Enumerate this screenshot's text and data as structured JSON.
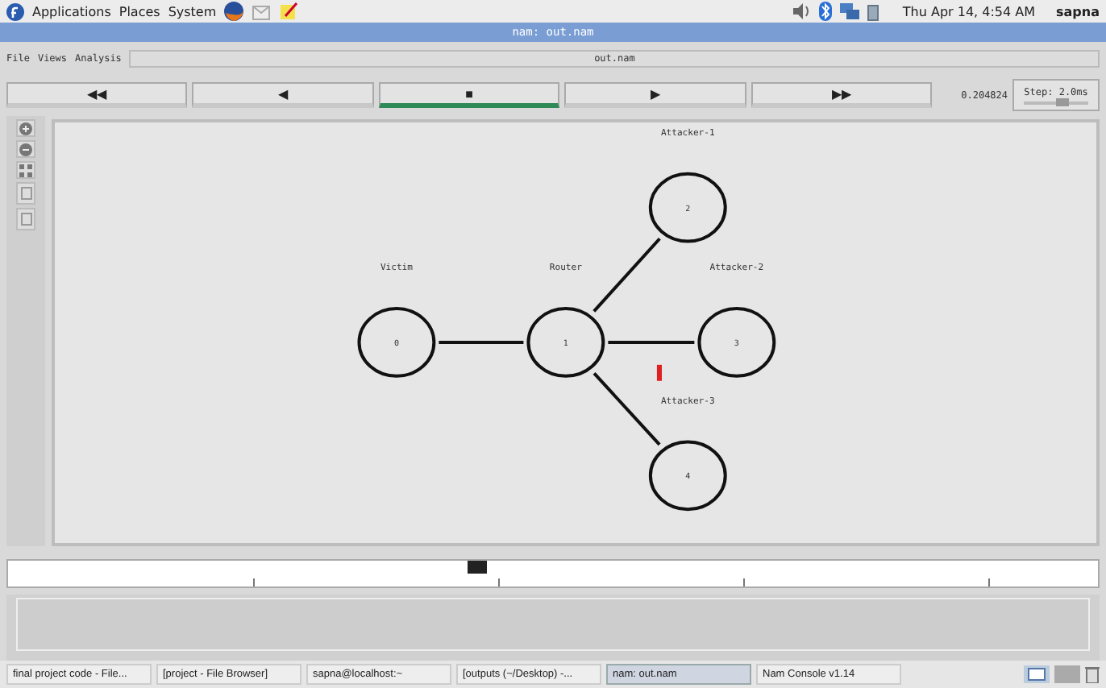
{
  "top_panel": {
    "menus": [
      "Applications",
      "Places",
      "System"
    ],
    "clock": "Thu Apr 14, 4:54 AM",
    "user": "sapna"
  },
  "window": {
    "title": "nam: out.nam"
  },
  "menubar": {
    "items": [
      "File",
      "Views",
      "Analysis"
    ],
    "file_name": "out.nam"
  },
  "playback": [
    {
      "label": "◀◀",
      "selected": false
    },
    {
      "label": "◀",
      "selected": false
    },
    {
      "label": "■",
      "selected": true
    },
    {
      "label": "▶",
      "selected": false
    },
    {
      "label": "▶▶",
      "selected": false
    }
  ],
  "time": "0.204824",
  "step": {
    "label": "Step: 2.0ms",
    "level": 0.6
  },
  "nodes": [
    {
      "id": "0",
      "label": "Victim"
    },
    {
      "id": "1",
      "label": "Router"
    },
    {
      "id": "2",
      "label": "Attacker-1"
    },
    {
      "id": "3",
      "label": "Attacker-2"
    },
    {
      "id": "4",
      "label": "Attacker-3"
    }
  ],
  "packets": [
    {
      "color": "#e02020"
    }
  ],
  "timeline": {
    "level": 0.43
  },
  "taskbar": [
    {
      "label": "final project code - File...",
      "selected": false
    },
    {
      "label": "[project - File Browser]",
      "selected": false
    },
    {
      "label": "sapna@localhost:~",
      "selected": false
    },
    {
      "label": "[outputs (~/Desktop) -...",
      "selected": false
    },
    {
      "label": "nam: out.nam",
      "selected": true
    },
    {
      "label": "Nam Console v1.14",
      "selected": false
    }
  ]
}
